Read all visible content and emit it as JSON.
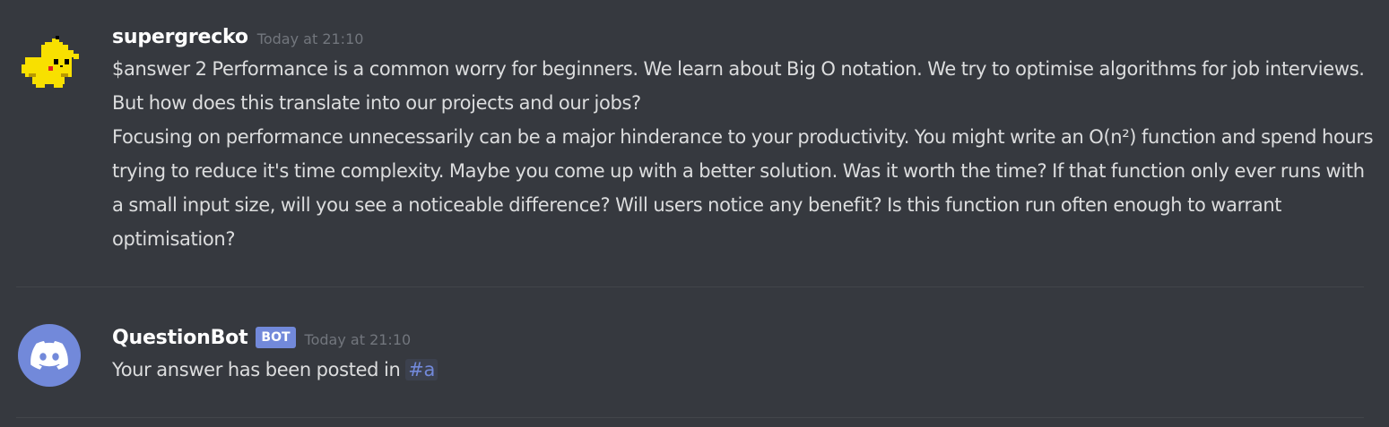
{
  "messages": [
    {
      "author": "supergrecko",
      "avatar_icon": "pixel-pikachu-avatar",
      "timestamp": "Today at 21:10",
      "lines": [
        "$answer 2 Performance is a common worry for beginners. We learn about Big O notation. We try to optimise algorithms for job interviews. But how does this translate into our projects and our jobs?",
        "Focusing on performance unnecessarily can be a major hinderance to your productivity. You might write an O(n²) function and spend hours trying to reduce it's time complexity. Maybe you come up with a better solution. Was it worth the time? If that function only ever runs with a small input size, will you see a noticeable difference? Will users notice any benefit? Is this function run often enough to warrant optimisation?"
      ]
    },
    {
      "author": "QuestionBot",
      "badge": "BOT",
      "avatar_icon": "discord-logo-avatar",
      "timestamp": "Today at 21:10",
      "text": "Your answer has been posted in ",
      "channel_mention": "#a"
    }
  ],
  "colors": {
    "background": "#36393f",
    "username": "#ffffff",
    "text": "#dcddde",
    "timestamp": "#72767d",
    "blurple": "#7289da",
    "pikachu_yellow": "#f8e000"
  }
}
